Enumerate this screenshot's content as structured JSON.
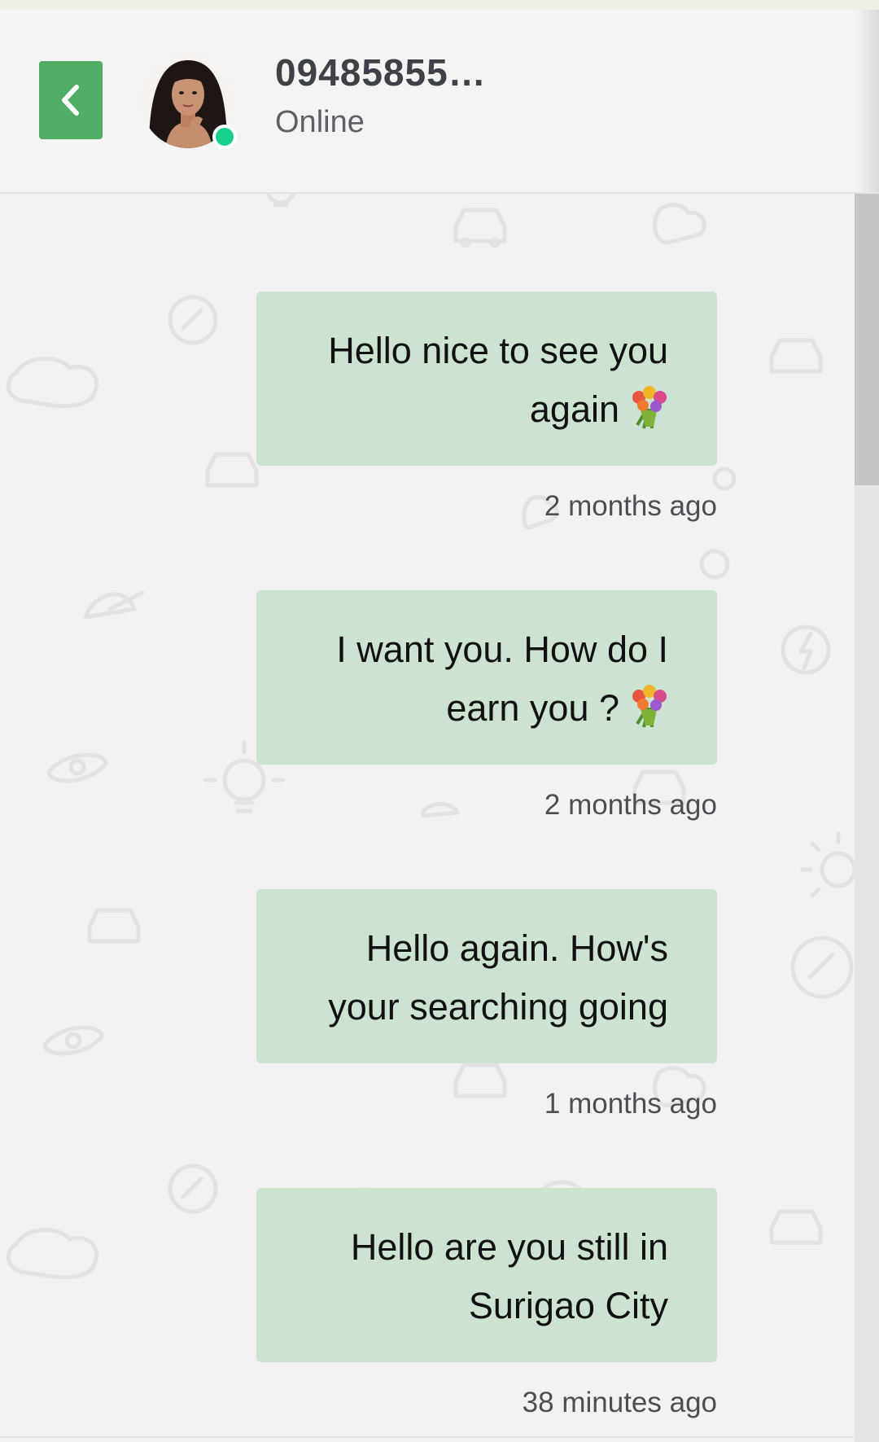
{
  "header": {
    "back_label": "Back",
    "contact_name": "09485855…",
    "contact_status": "Online"
  },
  "messages": [
    {
      "text": "Hello nice to see you again",
      "emoji": "bouquet-icon",
      "time": "2 months ago"
    },
    {
      "text": "I want you. How do I earn you ?",
      "emoji": "bouquet-icon",
      "time": "2 months ago"
    },
    {
      "text": "Hello again. How's your searching going",
      "emoji": "",
      "time": "1 months ago"
    },
    {
      "text": "Hello are you still in Surigao City",
      "emoji": "",
      "time": "38 minutes ago"
    }
  ],
  "colors": {
    "accent": "#4fae64",
    "bubble": "#cde3d2",
    "online": "#17d28f",
    "background": "#f2f2f2"
  }
}
